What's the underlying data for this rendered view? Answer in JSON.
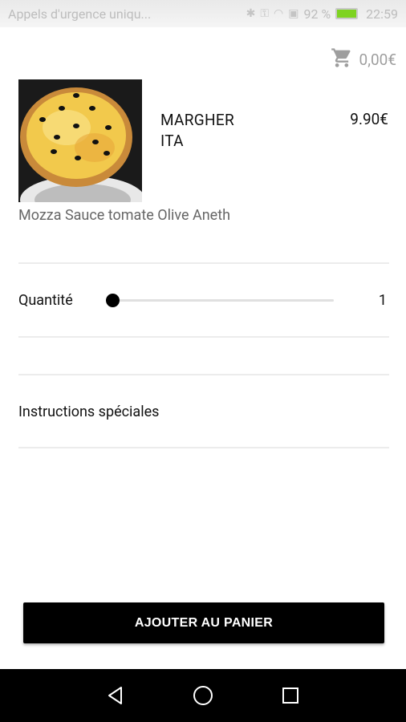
{
  "status_bar": {
    "carrier": "Appels d'urgence uniqu...",
    "battery": "92 %",
    "time": "22:59",
    "battery_color": "#7ed321"
  },
  "cart": {
    "icon": "cart-icon",
    "total": "0,00€"
  },
  "product": {
    "name": "MARGHER ITA",
    "price": "9.90€",
    "description": "Mozza Sauce tomate Olive Aneth",
    "image_alt": "pizza"
  },
  "quantity": {
    "label": "Quantité",
    "value": "1"
  },
  "instructions": {
    "label": "Instructions spéciales"
  },
  "actions": {
    "add_to_cart": "AJOUTER AU PANIER"
  },
  "nav": {
    "back": "back-icon",
    "home": "home-icon",
    "recents": "recents-icon"
  }
}
